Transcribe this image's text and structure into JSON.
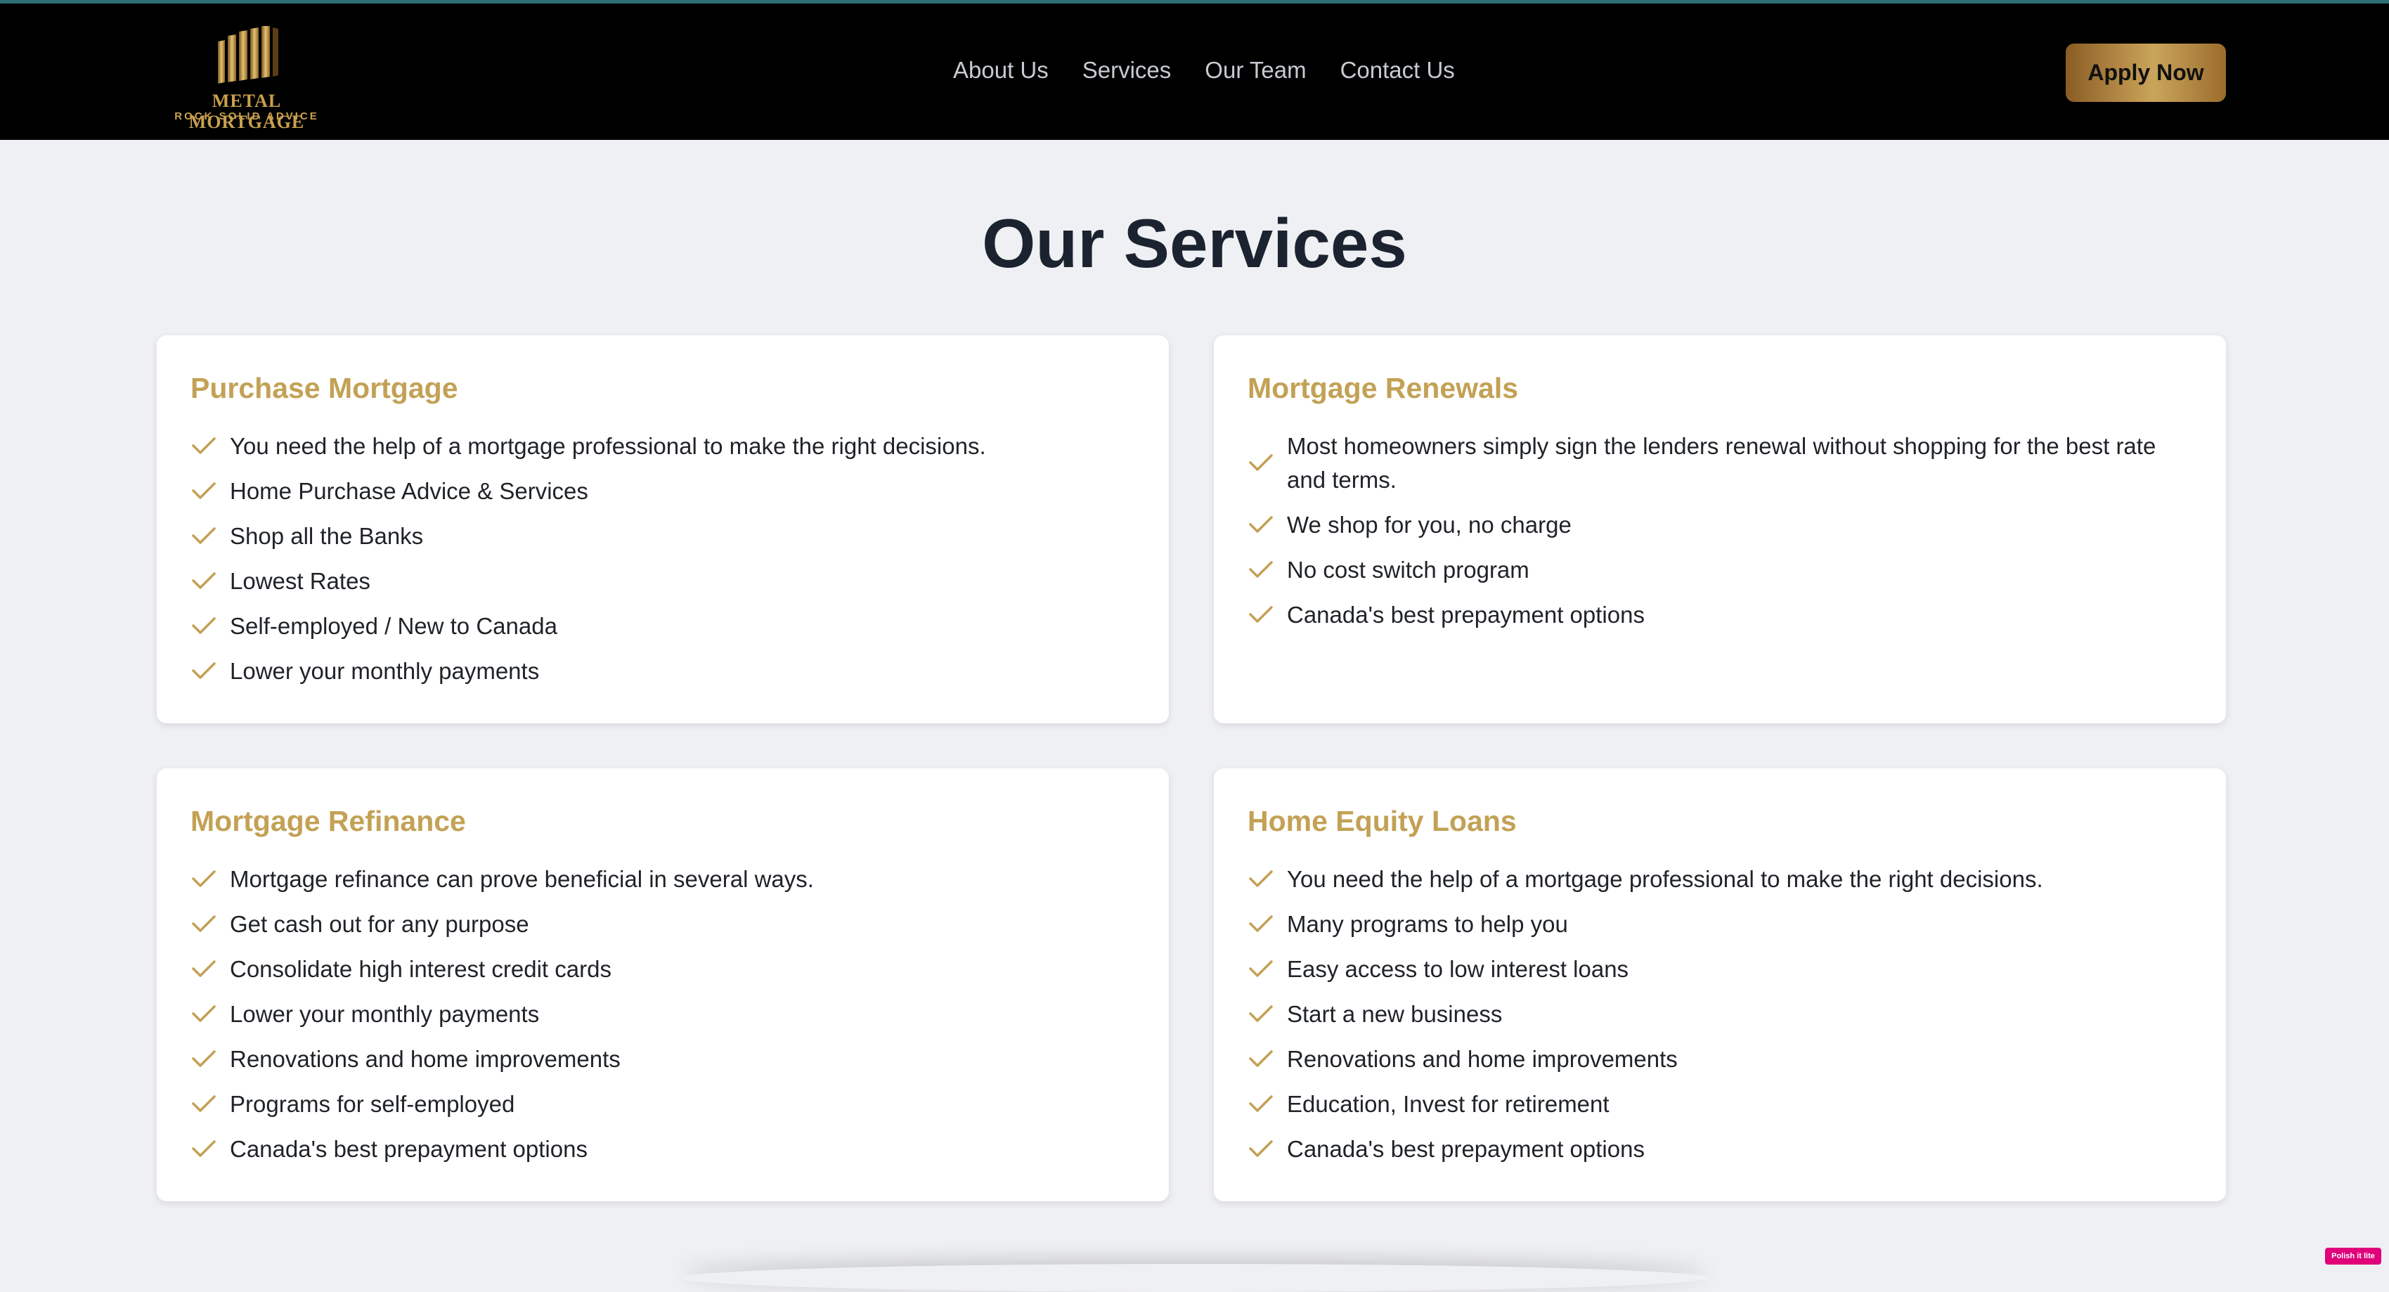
{
  "brand": {
    "name": "METAL MORTGAGE",
    "tagline": "ROCK SOLID ADVICE",
    "accent": "#c3a155"
  },
  "nav": {
    "links": [
      "About Us",
      "Services",
      "Our Team",
      "Contact Us"
    ],
    "cta": "Apply Now"
  },
  "main": {
    "heading": "Our Services",
    "cards": [
      {
        "title": "Purchase Mortgage",
        "items": [
          "You need the help of a mortgage professional to make the right decisions.",
          "Home Purchase Advice & Services",
          "Shop all the Banks",
          "Lowest Rates",
          "Self-employed / New to Canada",
          "Lower your monthly payments"
        ]
      },
      {
        "title": "Mortgage Renewals",
        "items": [
          "Most homeowners simply sign the lenders renewal without shopping for the best rate and terms.",
          "We shop for you, no charge",
          "No cost switch program",
          "Canada's best prepayment options"
        ]
      },
      {
        "title": "Mortgage Refinance",
        "items": [
          "Mortgage refinance can prove beneficial in several ways.",
          "Get cash out for any purpose",
          "Consolidate high interest credit cards",
          "Lower your monthly payments",
          "Renovations and home improvements",
          "Programs for self-employed",
          "Canada's best prepayment options"
        ]
      },
      {
        "title": "Home Equity Loans",
        "items": [
          "You need the help of a mortgage professional to make the right decisions.",
          "Many programs to help you",
          "Easy access to low interest loans",
          "Start a new business",
          "Renovations and home improvements",
          "Education, Invest for retirement",
          "Canada's best prepayment options"
        ]
      }
    ]
  },
  "overlay": {
    "badge": "Polish it lite"
  }
}
